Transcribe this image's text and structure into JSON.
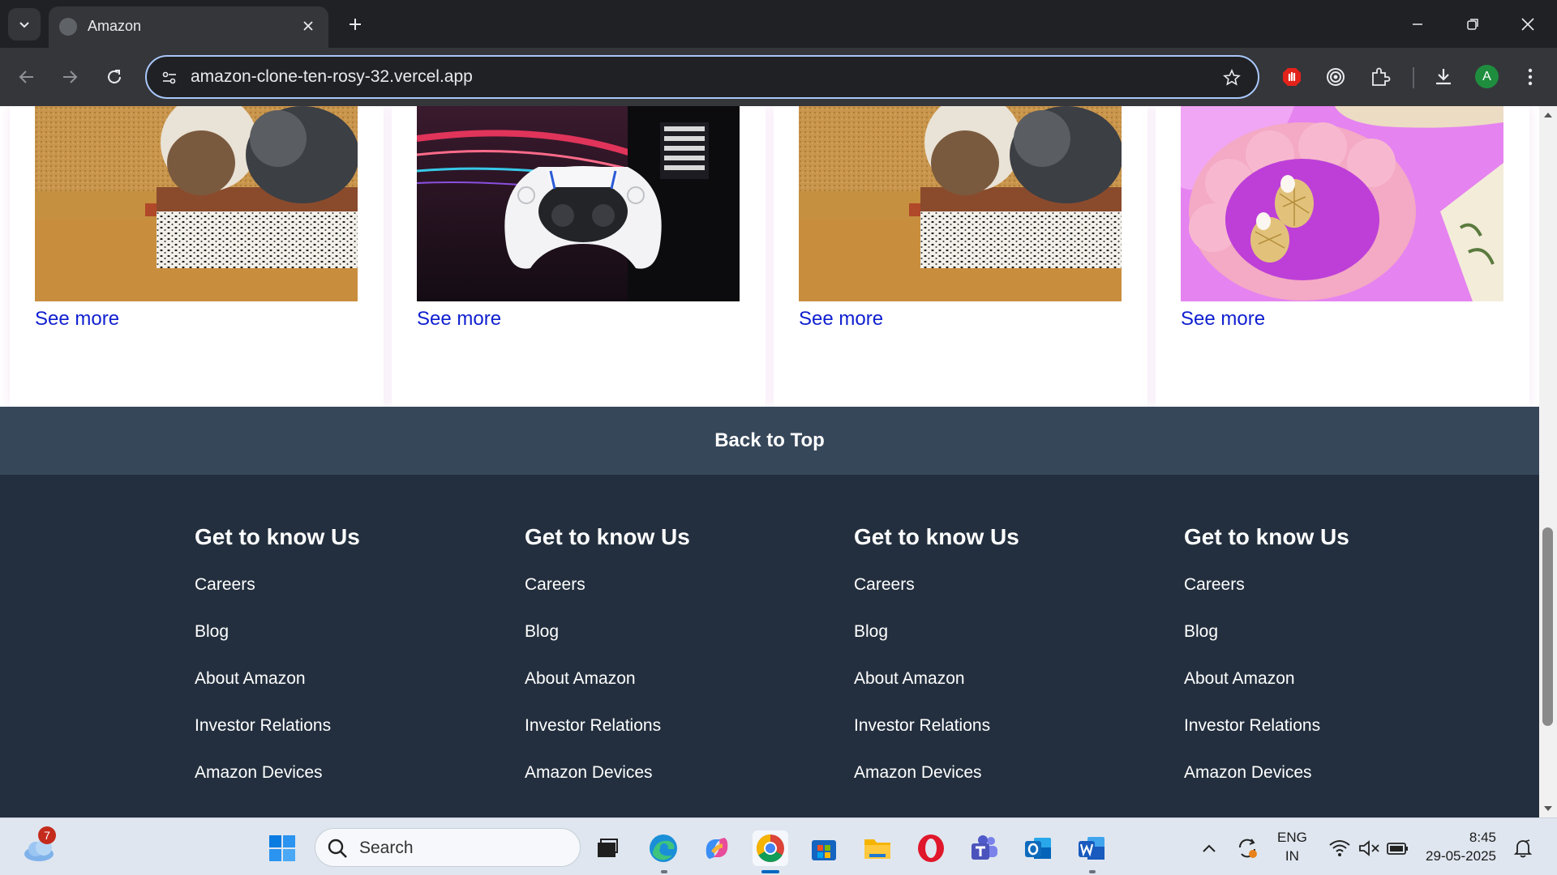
{
  "browser": {
    "tab_title": "Amazon",
    "url": "amazon-clone-ten-rosy-32.vercel.app",
    "profile_initial": "A"
  },
  "cards": [
    {
      "link": "See more",
      "image": "cat-in-box"
    },
    {
      "link": "See more",
      "image": "game-controller"
    },
    {
      "link": "See more",
      "image": "cat-in-box"
    },
    {
      "link": "See more",
      "image": "pink-earrings"
    }
  ],
  "back_to_top": "Back to Top",
  "footer": {
    "columns": [
      {
        "title": "Get to know Us",
        "links": [
          "Careers",
          "Blog",
          "About Amazon",
          "Investor Relations",
          "Amazon Devices"
        ]
      },
      {
        "title": "Get to know Us",
        "links": [
          "Careers",
          "Blog",
          "About Amazon",
          "Investor Relations",
          "Amazon Devices"
        ]
      },
      {
        "title": "Get to know Us",
        "links": [
          "Careers",
          "Blog",
          "About Amazon",
          "Investor Relations",
          "Amazon Devices"
        ]
      },
      {
        "title": "Get to know Us",
        "links": [
          "Careers",
          "Blog",
          "About Amazon",
          "Investor Relations",
          "Amazon Devices"
        ]
      }
    ]
  },
  "taskbar": {
    "weather_badge": "7",
    "search_placeholder": "Search",
    "lang_line1": "ENG",
    "lang_line2": "IN",
    "time": "8:45",
    "date": "29-05-2025"
  },
  "colors": {
    "link": "#1020d0",
    "back_to_top_bg": "#37475a",
    "footer_bg": "#232f3e"
  }
}
